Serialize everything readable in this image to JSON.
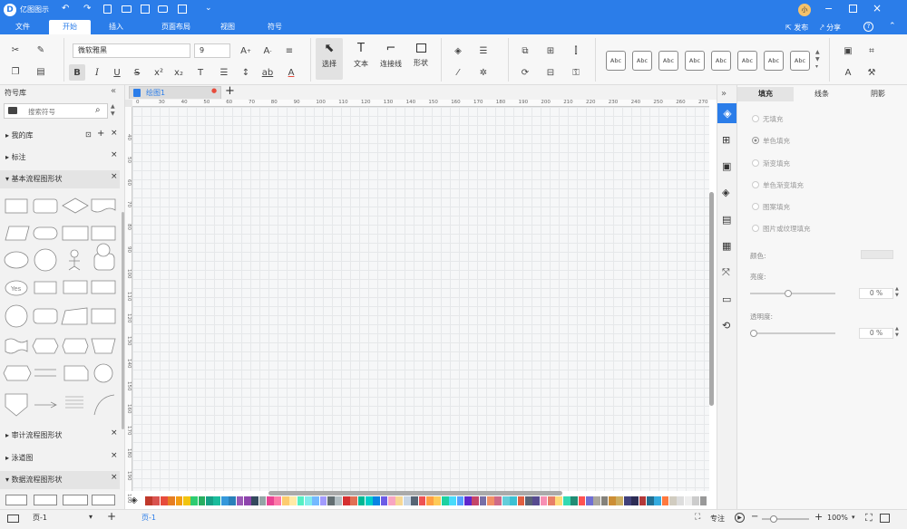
{
  "app": {
    "title": "亿图图示",
    "user_avatar": "小",
    "publish": "发布",
    "share": "分享",
    "help": "?"
  },
  "menus": [
    "文件",
    "开始",
    "插入",
    "页面布局",
    "视图",
    "符号"
  ],
  "ribbon": {
    "font_name": "微软雅黑",
    "font_size": "9",
    "tools": [
      {
        "label": "选择"
      },
      {
        "label": "文本"
      },
      {
        "label": "连接线"
      },
      {
        "label": "形状"
      }
    ],
    "style_labels": [
      "Abc",
      "Abc",
      "Abc",
      "Abc",
      "Abc",
      "Abc",
      "Abc",
      "Abc"
    ]
  },
  "left_panel": {
    "title": "符号库",
    "search_placeholder": "搜索符号",
    "libraries": [
      {
        "name": "我的库"
      },
      {
        "name": "标注"
      },
      {
        "name": "基本流程图形状"
      }
    ],
    "collapsed_libraries": [
      {
        "name": "审计流程图形状"
      },
      {
        "name": "泳道图"
      },
      {
        "name": "数据流程图形状"
      }
    ],
    "yes_shape_label": "Yes"
  },
  "document": {
    "tab_name": "绘图1",
    "modified_marker": "●"
  },
  "ruler": {
    "h_ticks": [
      "0",
      "30",
      "40",
      "50",
      "60",
      "70",
      "80",
      "90",
      "100",
      "110",
      "120",
      "130",
      "140",
      "150",
      "160",
      "170",
      "180",
      "190",
      "200",
      "210",
      "220",
      "230",
      "240",
      "250",
      "260",
      "270"
    ],
    "v_ticks": [
      "40",
      "50",
      "60",
      "70",
      "80",
      "90",
      "100",
      "110",
      "120",
      "130",
      "140",
      "150",
      "160",
      "170",
      "180",
      "190",
      "100"
    ]
  },
  "right_panel": {
    "tabs": [
      "填充",
      "线条",
      "阴影"
    ],
    "fill_options": [
      "无填充",
      "单色填充",
      "渐变填充",
      "单色渐变填充",
      "图案填充",
      "图片或纹理填充"
    ],
    "selected_fill": "单色填充",
    "color_label": "颜色:",
    "brightness_label": "亮度:",
    "brightness_value": "0 %",
    "transparency_label": "透明度:",
    "transparency_value": "0 %",
    "brightness_level": 0.45,
    "transparency_level": 0.0
  },
  "status": {
    "page_select": "页-1",
    "page_tab": "页-1",
    "focus": "专注",
    "zoom": "100%"
  },
  "palette_colors": [
    "#c0392b",
    "#d9534f",
    "#e74c3c",
    "#e67e22",
    "#f39c12",
    "#f1c40f",
    "#2ecc71",
    "#27ae60",
    "#16a085",
    "#1abc9c",
    "#3498db",
    "#2980b9",
    "#9b59b6",
    "#8e44ad",
    "#34495e",
    "#95a5a6",
    "#e84393",
    "#fd79a8",
    "#fdcb6e",
    "#ffeaa7",
    "#55efc4",
    "#81ecec",
    "#74b9ff",
    "#a29bfe",
    "#636e72",
    "#b2bec3",
    "#d63031",
    "#e17055",
    "#00b894",
    "#00cec9",
    "#0984e3",
    "#6c5ce7",
    "#f8a5c2",
    "#f7d794",
    "#c8d6e5",
    "#576574",
    "#ee5253",
    "#ff9f43",
    "#feca57",
    "#1dd1a1",
    "#48dbfb",
    "#54a0ff",
    "#5f27cd",
    "#c44569",
    "#786fa6",
    "#f19066",
    "#cf6a87",
    "#63cdda",
    "#3dc1d3",
    "#e15f41",
    "#596275",
    "#574b90",
    "#f78fb3",
    "#e77f67",
    "#ffda79",
    "#33d9b2",
    "#218c74",
    "#ff5252",
    "#706fd3",
    "#aaa69d",
    "#84817a",
    "#cc8e35",
    "#ccae62",
    "#40407a",
    "#2c2c54",
    "#b33939",
    "#227093",
    "#34ace0",
    "#ff793f",
    "#d1ccc0",
    "#dddddd",
    "#eeeeee",
    "#cccccc",
    "#999999"
  ]
}
